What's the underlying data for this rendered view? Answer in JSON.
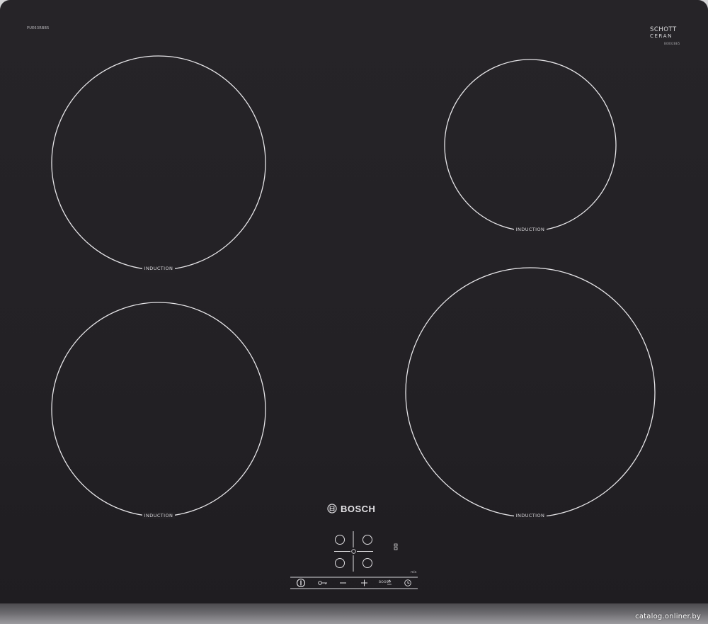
{
  "model_code": "PUE63RBB5",
  "glass_brand": {
    "line1": "SCHOTT",
    "line2": "CERAN",
    "code": "B0002BE5"
  },
  "zones": [
    {
      "id": "front-left-top",
      "label": "INDUCTION"
    },
    {
      "id": "rear-right",
      "label": "INDUCTION"
    },
    {
      "id": "front-left-bottom",
      "label": "INDUCTION"
    },
    {
      "id": "front-right",
      "label": "INDUCTION"
    }
  ],
  "brand": {
    "name": "BOSCH"
  },
  "controls": {
    "min_label": "min",
    "boost_label": "BOOST"
  },
  "watermark": "catalog.onliner.by",
  "colors": {
    "glass": "#242226",
    "outline": "#e6e5e8",
    "frame": "#6b6a6e"
  }
}
